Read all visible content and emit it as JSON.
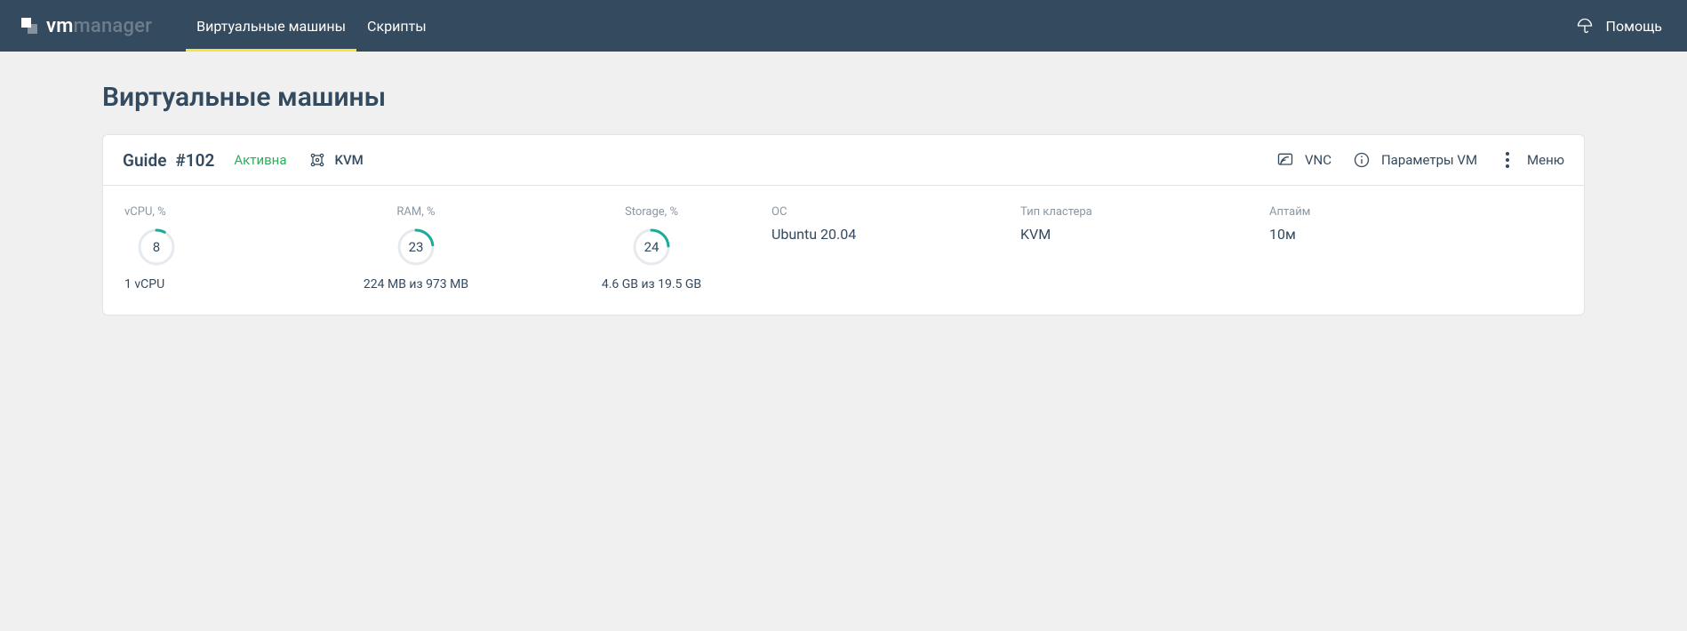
{
  "header": {
    "logo_bold": "vm",
    "logo_dim": "manager",
    "nav": [
      {
        "label": "Виртуальные машины",
        "active": true
      },
      {
        "label": "Скрипты",
        "active": false
      }
    ],
    "help": "Помощь"
  },
  "page": {
    "title": "Виртуальные машины"
  },
  "vm": {
    "name": "Guide",
    "id": "#102",
    "status": "Активна",
    "virt_type": "KVM",
    "actions": {
      "vnc": "VNC",
      "params": "Параметры VM",
      "menu": "Меню"
    },
    "gauges": {
      "vcpu": {
        "label": "vCPU, %",
        "value": 8,
        "detail": "1 vCPU"
      },
      "ram": {
        "label": "RAM, %",
        "value": 23,
        "detail": "224 MB из 973 MB"
      },
      "storage": {
        "label": "Storage, %",
        "value": 24,
        "detail": "4.6 GB из 19.5 GB"
      }
    },
    "info": {
      "os": {
        "label": "ОС",
        "value": "Ubuntu 20.04"
      },
      "cluster": {
        "label": "Тип кластера",
        "value": "KVM"
      },
      "uptime": {
        "label": "Аптайм",
        "value": "10м"
      }
    }
  }
}
